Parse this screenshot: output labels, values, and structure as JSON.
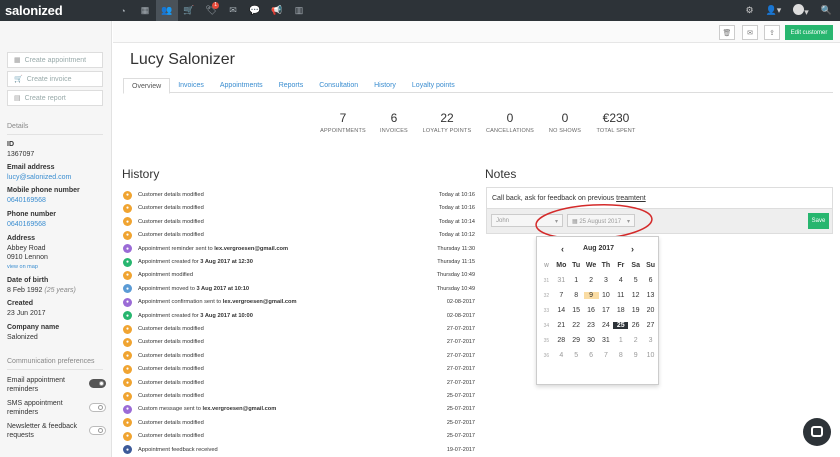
{
  "app": {
    "logo": "salonized"
  },
  "nav": {
    "badge": "1"
  },
  "sidebar": {
    "buttons": [
      "Create appointment",
      "Create invoice",
      "Create report"
    ],
    "details_title": "Details",
    "fields": [
      {
        "label": "ID",
        "value": "1367097"
      },
      {
        "label": "Email address",
        "value": "lucy@salonized.com"
      },
      {
        "label": "Mobile phone number",
        "value": "0640169568"
      },
      {
        "label": "Phone number",
        "value": "0640169568"
      },
      {
        "label": "Address",
        "value": "Abbey Road"
      },
      {
        "label": "Date of birth",
        "value": "8 Feb 1992"
      },
      {
        "label": "Created",
        "value": "23 Jun 2017"
      },
      {
        "label": "Company name",
        "value": "Salonized"
      }
    ],
    "address2": "0910 Lennon",
    "view_on_map": "view on map",
    "dob_extra": "(25 years)",
    "comm_title": "Communication preferences",
    "prefs": [
      {
        "label": "Email appointment reminders",
        "on": true
      },
      {
        "label": "SMS appointment reminders",
        "on": false
      },
      {
        "label": "Newsletter & feedback requests",
        "on": false
      }
    ]
  },
  "header": {
    "edit_label": "Edit customer",
    "customer_name": "Lucy Salonizer"
  },
  "tabs": [
    "Overview",
    "Invoices",
    "Appointments",
    "Reports",
    "Consultation",
    "History",
    "Loyalty points"
  ],
  "stats": [
    {
      "num": "7",
      "cap": "APPOINTMENTS"
    },
    {
      "num": "6",
      "cap": "INVOICES"
    },
    {
      "num": "22",
      "cap": "LOYALTY POINTS"
    },
    {
      "num": "0",
      "cap": "CANCELLATIONS"
    },
    {
      "num": "0",
      "cap": "NO SHOWS"
    },
    {
      "num": "€230",
      "cap": "TOTAL SPENT"
    }
  ],
  "history": {
    "title": "History",
    "rows": [
      {
        "icon": "orange",
        "text": "Customer details modified",
        "bold": "",
        "time": "Today at 10:16"
      },
      {
        "icon": "orange",
        "text": "Customer details modified",
        "bold": "",
        "time": "Today at 10:16"
      },
      {
        "icon": "orange",
        "text": "Customer details modified",
        "bold": "",
        "time": "Today at 10:14"
      },
      {
        "icon": "orange",
        "text": "Customer details modified",
        "bold": "",
        "time": "Today at 10:12"
      },
      {
        "icon": "purple",
        "text": "Appointment reminder sent to ",
        "bold": "lex.vergroesen@gmail.com",
        "time": "Thursday 11:30"
      },
      {
        "icon": "green",
        "text": "Appointment created for ",
        "bold": "3 Aug 2017 at 12:30",
        "time": "Thursday 11:15"
      },
      {
        "icon": "orange",
        "text": "Appointment modified",
        "bold": "",
        "time": "Thursday 10:49"
      },
      {
        "icon": "blue",
        "text": "Appointment moved to ",
        "bold": "3 Aug 2017 at 10:10",
        "time": "Thursday 10:49"
      },
      {
        "icon": "purple",
        "text": "Appointment confirmation sent to ",
        "bold": "lex.vergroesen@gmail.com",
        "time": "02-08-2017"
      },
      {
        "icon": "green",
        "text": "Appointment created for ",
        "bold": "3 Aug 2017 at 10:00",
        "time": "02-08-2017"
      },
      {
        "icon": "orange",
        "text": "Customer details modified",
        "bold": "",
        "time": "27-07-2017"
      },
      {
        "icon": "orange",
        "text": "Customer details modified",
        "bold": "",
        "time": "27-07-2017"
      },
      {
        "icon": "orange",
        "text": "Customer details modified",
        "bold": "",
        "time": "27-07-2017"
      },
      {
        "icon": "orange",
        "text": "Customer details modified",
        "bold": "",
        "time": "27-07-2017"
      },
      {
        "icon": "orange",
        "text": "Customer details modified",
        "bold": "",
        "time": "27-07-2017"
      },
      {
        "icon": "orange",
        "text": "Customer details modified",
        "bold": "",
        "time": "25-07-2017"
      },
      {
        "icon": "purple",
        "text": "Custom message sent to ",
        "bold": "lex.vergroesen@gmail.com",
        "time": "25-07-2017"
      },
      {
        "icon": "orange",
        "text": "Customer details modified",
        "bold": "",
        "time": "25-07-2017"
      },
      {
        "icon": "orange",
        "text": "Customer details modified",
        "bold": "",
        "time": "25-07-2017"
      },
      {
        "icon": "navy",
        "text": "Appointment feedback received",
        "bold": "",
        "time": "19-07-2017"
      }
    ]
  },
  "notes": {
    "title": "Notes",
    "text": "Call back, ask for feedback on previous ",
    "text_misspelled": "treamtent",
    "user_select": "John",
    "date_select": "25 August 2017",
    "save_label": "Save"
  },
  "calendar": {
    "month": "Aug 2017",
    "weekdays": [
      "W",
      "Mo",
      "Tu",
      "We",
      "Th",
      "Fr",
      "Sa",
      "Su"
    ],
    "weeks": [
      {
        "wk": "31",
        "days": [
          "31",
          "1",
          "2",
          "3",
          "4",
          "5",
          "6"
        ]
      },
      {
        "wk": "32",
        "days": [
          "7",
          "8",
          "9",
          "10",
          "11",
          "12",
          "13"
        ]
      },
      {
        "wk": "33",
        "days": [
          "14",
          "15",
          "16",
          "17",
          "18",
          "19",
          "20"
        ]
      },
      {
        "wk": "34",
        "days": [
          "21",
          "22",
          "23",
          "24",
          "25",
          "26",
          "27"
        ]
      },
      {
        "wk": "35",
        "days": [
          "28",
          "29",
          "30",
          "31",
          "1",
          "2",
          "3"
        ]
      },
      {
        "wk": "36",
        "days": [
          "4",
          "5",
          "6",
          "7",
          "8",
          "9",
          "10"
        ]
      }
    ]
  },
  "colors": {
    "orange": "#f0a431",
    "purple": "#9b6bd6",
    "green": "#27b66f",
    "blue": "#5b9bd5",
    "navy": "#3d5a99",
    "accent": "#27b66f"
  }
}
